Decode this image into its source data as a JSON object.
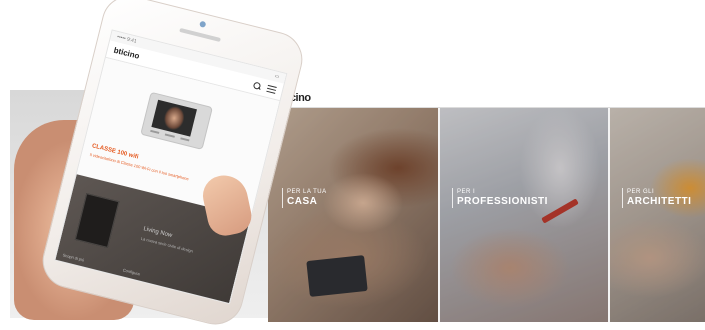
{
  "desktop": {
    "logo": "bticino",
    "tiles": [
      {
        "kicker": "PER LA TUA",
        "title": "CASA"
      },
      {
        "kicker": "PER I",
        "title": "PROFESSIONISTI"
      },
      {
        "kicker": "PER GLI",
        "title": "ARCHITETTI"
      }
    ]
  },
  "phone": {
    "status_left": "••••• 9:41",
    "status_right": "▭",
    "logo": "bticino",
    "product_title": "CLASSE 100 wifi",
    "product_desc": "Il videocitofono di Classe 100 Wi-Fi con il tuo smartphone",
    "dark_title": "Living Now",
    "dark_desc": "La nuova serie civile di design",
    "dark_links": [
      "Scopri di più",
      "Configura"
    ]
  },
  "colors": {
    "accent": "#e5591f",
    "header_bg": "#ffffff"
  }
}
